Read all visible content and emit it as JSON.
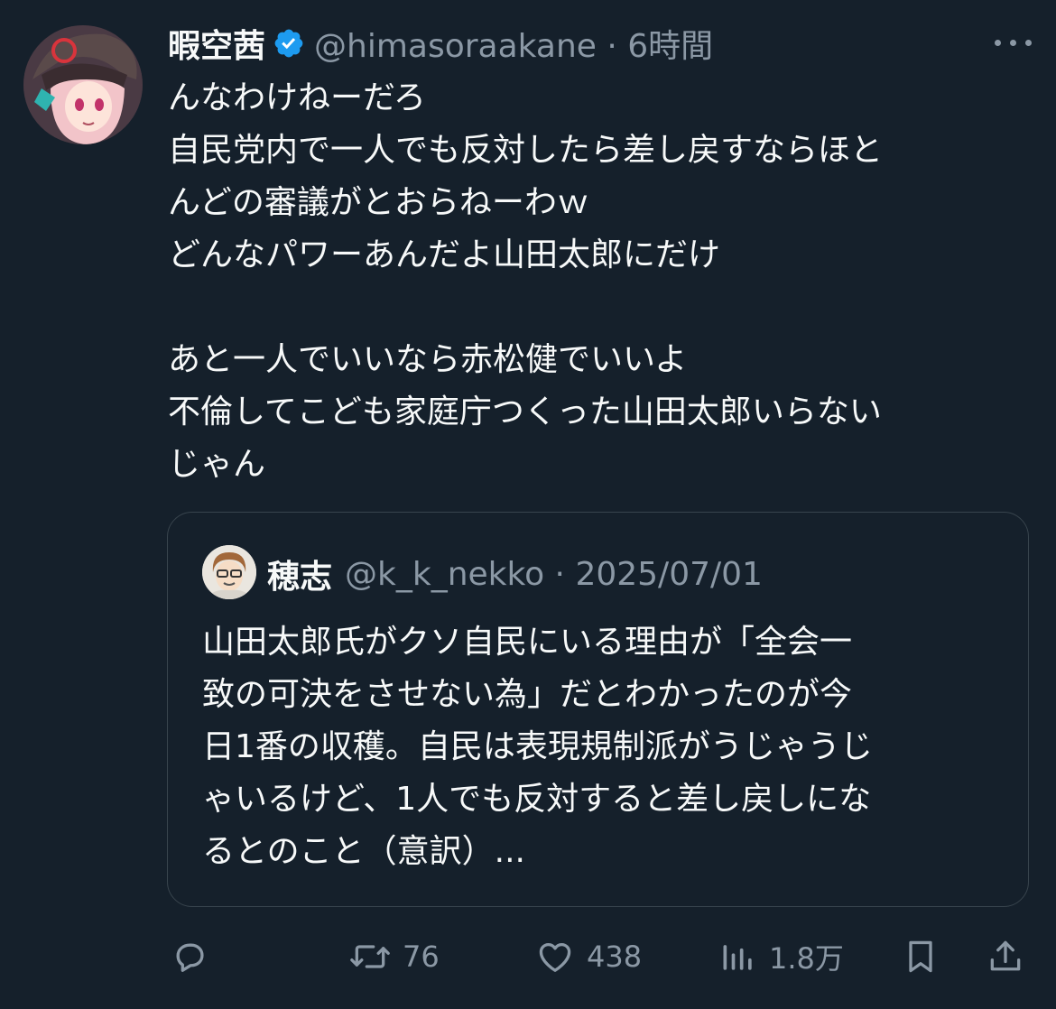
{
  "post": {
    "author_name": "暇空茜",
    "author_handle": "@himasoraakane",
    "time": "6時間",
    "handle_time": "@himasoraakane · 6時間",
    "lines": [
      "んなわけねーだろ",
      "自民党内で一人でも反対したら差し戻すならほと",
      "んどの審議がとおらねーわｗ",
      "どんなパワーあんだよ山田太郎にだけ",
      "",
      "あと一人でいいなら赤松健でいいよ",
      "不倫してこども家庭庁つくった山田太郎いらない",
      "じゃん"
    ]
  },
  "quote": {
    "author_name": "穂志",
    "handle_date": "@k_k_nekko · 2025/07/01",
    "lines": [
      "山田太郎氏がクソ自民にいる理由が「全会一",
      "致の可決をさせない為」だとわかったのが今",
      "日1番の収穫。自民は表現規制派がうじゃうじ",
      "ゃいるけど、1人でも反対すると差し戻しにな",
      "るとのこと（意訳）..."
    ]
  },
  "actions": {
    "reply_icon": "reply-icon",
    "retweet_count": "76",
    "like_count": "438",
    "view_count": "1.8万",
    "bookmark_icon": "bookmark-icon",
    "share_icon": "share-icon"
  },
  "colors": {
    "background": "#15202b",
    "text": "#f7f9f9",
    "secondary": "#8b98a5",
    "border": "#38444d",
    "verified": "#1d9bf0"
  }
}
